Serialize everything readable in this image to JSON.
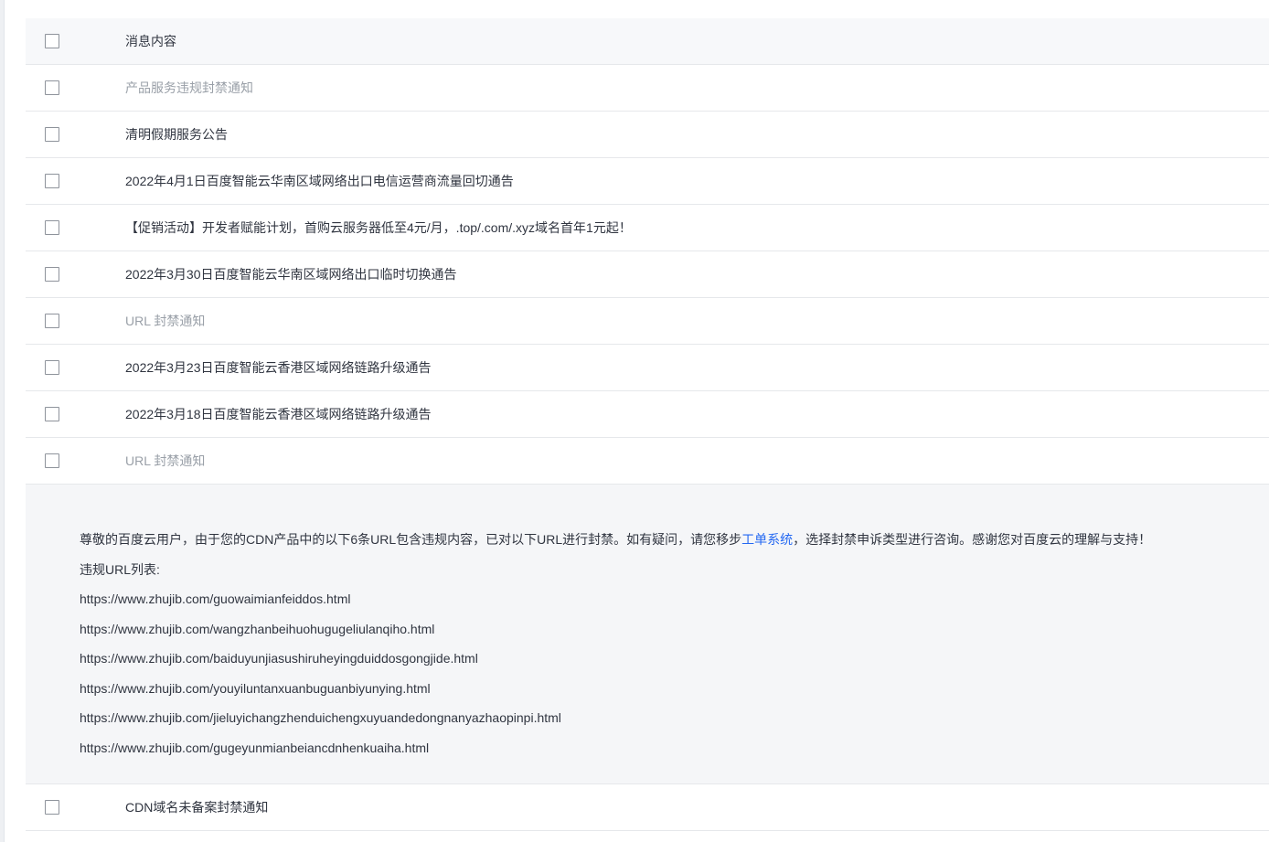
{
  "table": {
    "header": {
      "label": "消息内容"
    },
    "rows": [
      {
        "title": "产品服务违规封禁通知",
        "read": true
      },
      {
        "title": "清明假期服务公告",
        "read": false
      },
      {
        "title": "2022年4月1日百度智能云华南区域网络出口电信运营商流量回切通告",
        "read": false
      },
      {
        "title": "【促销活动】开发者赋能计划，首购云服务器低至4元/月，.top/.com/.xyz域名首年1元起！",
        "read": false
      },
      {
        "title": "2022年3月30日百度智能云华南区域网络出口临时切换通告",
        "read": false
      },
      {
        "title": "URL 封禁通知",
        "read": true
      },
      {
        "title": "2022年3月23日百度智能云香港区域网络链路升级通告",
        "read": false
      },
      {
        "title": "2022年3月18日百度智能云香港区域网络链路升级通告",
        "read": false
      },
      {
        "title": "URL 封禁通知",
        "read": true
      }
    ],
    "detail": {
      "text_before_link": "尊敬的百度云用户，由于您的CDN产品中的以下6条URL包含违规内容，已对以下URL进行封禁。如有疑问，请您移步",
      "link": "工单系统",
      "text_after_link": "，选择封禁申诉类型进行咨询。感谢您对百度云的理解与支持！",
      "list_label": "违规URL列表:",
      "urls": [
        "https://www.zhujib.com/guowaimianfeiddos.html",
        "https://www.zhujib.com/wangzhanbeihuohugugeliulanqiho.html",
        "https://www.zhujib.com/baiduyunjiasushiruheyingduiddosgongjide.html",
        "https://www.zhujib.com/youyiluntanxuanbuguanbiyunying.html",
        "https://www.zhujib.com/jieluyichangzhenduichengxuyuandedongnanyazhaopinpi.html",
        "https://www.zhujib.com/gugeyunmianbeiancdnhenkuaiha.html"
      ]
    },
    "last_row": {
      "title": "CDN域名未备案封禁通知",
      "read": false
    }
  },
  "colors": {
    "text": "#303540",
    "read_text": "#9aa0a8",
    "link": "#2468f2",
    "header_bg": "#f7f8fa",
    "detail_bg": "#f5f6f8"
  }
}
